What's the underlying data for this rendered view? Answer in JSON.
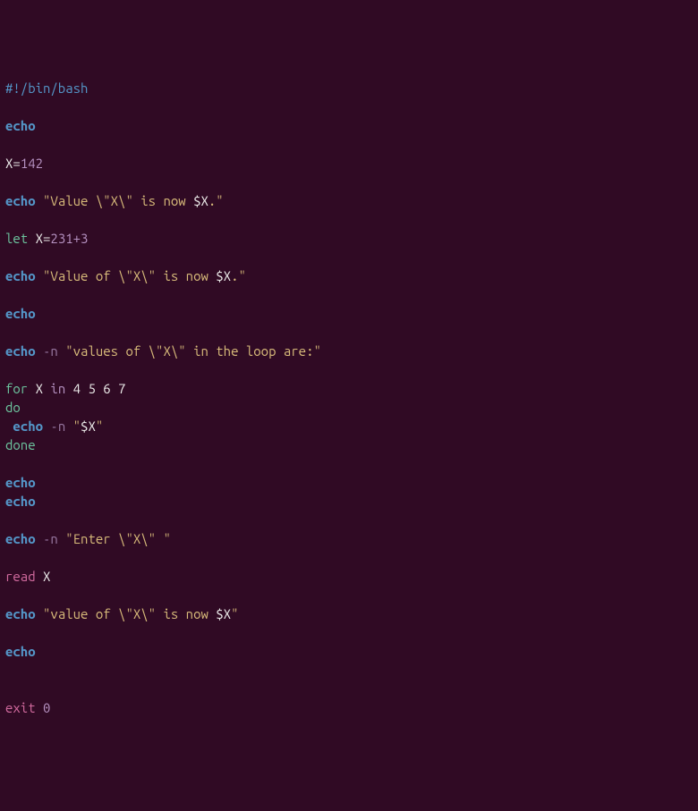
{
  "shebang": "#!/bin/bash",
  "kw": {
    "echo": "echo",
    "let": "let",
    "for": "for",
    "in": "in",
    "do": "do",
    "done": "done",
    "read": "read",
    "exit": "exit"
  },
  "flags": {
    "n": "-n"
  },
  "vars": {
    "X": "X"
  },
  "ops": {
    "eq": "="
  },
  "nums": {
    "n142": "142",
    "n231p3": "231+3",
    "loop_vals": "4 5 6 7",
    "zero": "0"
  },
  "strings": {
    "q": "\"",
    "val1_a": "Value \\",
    "val1_b": "X\\",
    "val1_c": " is now ",
    "val1_d": ".",
    "dollarX": "$X",
    "val2_a": "Value of \\",
    "val2_b": "X\\",
    "val2_c": " is now ",
    "val2_d": ".",
    "loop_a": "values of \\",
    "loop_b": "X\\",
    "loop_c": " in the loop are:",
    "enter_a": "Enter \\",
    "enter_b": "X\\",
    "enter_c": " ",
    "val3_a": "value of \\",
    "val3_b": "X\\",
    "val3_c": " is now "
  }
}
